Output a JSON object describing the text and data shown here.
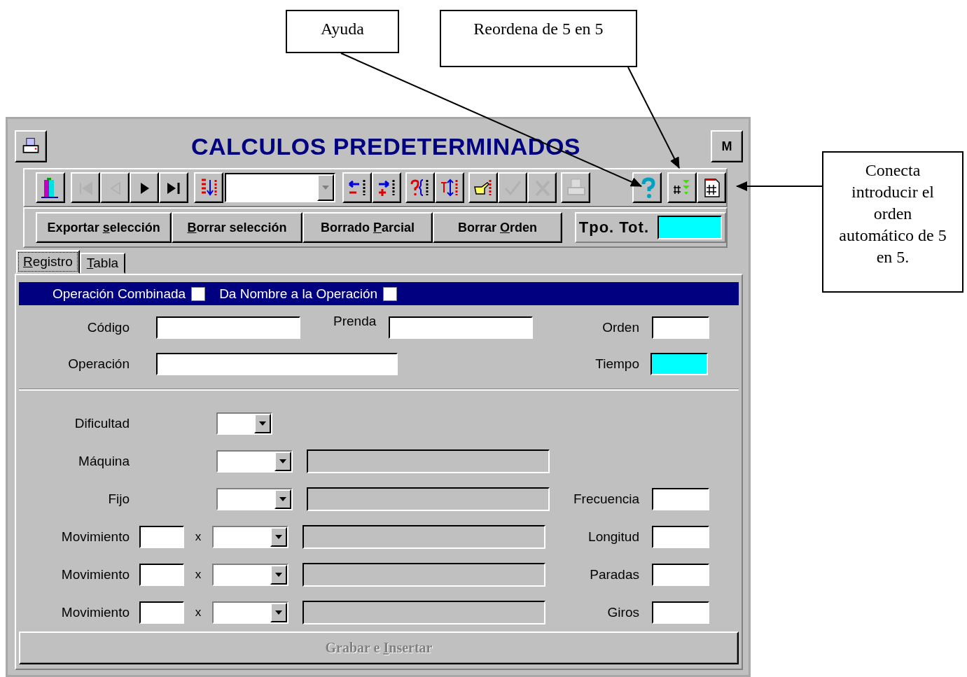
{
  "annotations": [
    {
      "text": "Ayuda"
    },
    {
      "text": "Reordena de 5 en 5"
    },
    {
      "text": "Conecta introducir el orden automático de 5 en 5."
    }
  ],
  "window": {
    "title": "CALCULOS PREDETERMINADOS",
    "corner_button": "M"
  },
  "toolbar": [
    {
      "kind": "button",
      "disabled": false
    },
    {
      "kind": "button",
      "disabled": true
    },
    {
      "kind": "button",
      "disabled": true
    },
    {
      "kind": "button",
      "disabled": false
    },
    {
      "kind": "button",
      "disabled": false
    },
    {
      "kind": "button",
      "disabled": false
    },
    {
      "kind": "combo",
      "disabled": false
    },
    {
      "kind": "button",
      "disabled": false
    },
    {
      "kind": "button",
      "disabled": false
    },
    {
      "kind": "button",
      "disabled": false
    },
    {
      "kind": "button",
      "disabled": false
    },
    {
      "kind": "button",
      "disabled": false
    },
    {
      "kind": "button",
      "disabled": true
    },
    {
      "kind": "button",
      "disabled": true
    },
    {
      "kind": "button",
      "disabled": true
    },
    {
      "kind": "button",
      "disabled": false
    },
    {
      "kind": "button",
      "disabled": false
    },
    {
      "kind": "button",
      "disabled": false
    }
  ],
  "actions": [
    {
      "before": "Exportar ",
      "key": "s",
      "after": "elección"
    },
    {
      "key": "B",
      "after": "orrar selección"
    },
    {
      "before": "Borrado ",
      "key": "P",
      "after": "arcial"
    },
    {
      "before": "Borrar ",
      "key": "O",
      "after": "rden"
    }
  ],
  "total": {
    "label": "Tpo. Tot."
  },
  "tabs": [
    {
      "key": "R",
      "after": "egistro",
      "selected": true
    },
    {
      "key": "T",
      "after": "abla",
      "selected": false
    }
  ],
  "options": [
    {
      "label": "Operación Combinada",
      "checked": false
    },
    {
      "label": "Da Nombre a la Operación",
      "checked": false
    }
  ],
  "header_fields": {
    "codigo": "Código",
    "prenda": "Prenda",
    "orden": "Orden",
    "operacion": "Operación",
    "tiempo": "Tiempo"
  },
  "rows": [
    {
      "kind": "short",
      "label": "Dificultad"
    },
    {
      "kind": "combo",
      "label": "Máquina"
    },
    {
      "kind": "combo",
      "label": "Fijo",
      "side_label": "Frecuencia"
    },
    {
      "kind": "count",
      "label": "Movimiento",
      "times": "x",
      "side_label": "Longitud"
    },
    {
      "kind": "count",
      "label": "Movimiento",
      "times": "x",
      "side_label": "Paradas"
    },
    {
      "kind": "count",
      "label": "Movimiento",
      "times": "x",
      "side_label": "Giros"
    }
  ],
  "save_button": {
    "before": "Grabar e ",
    "key": "I",
    "after": "nsertar",
    "disabled": true
  }
}
